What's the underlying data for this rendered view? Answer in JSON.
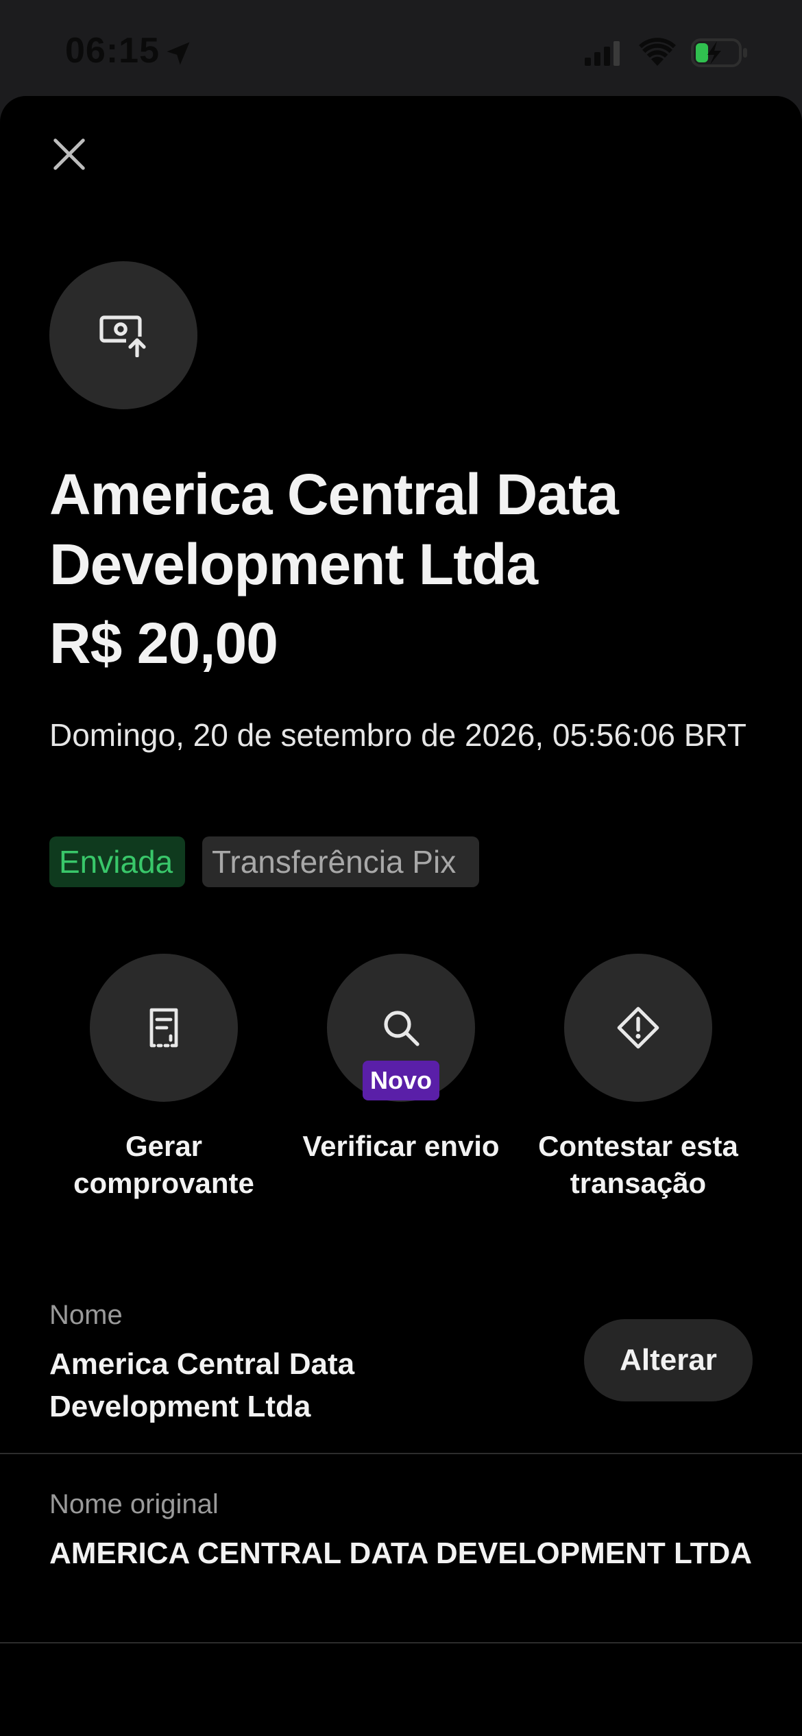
{
  "status_bar": {
    "time": "06:15",
    "icons": [
      "location-arrow-icon",
      "cellular-signal-icon",
      "wifi-icon",
      "battery-charging-icon"
    ]
  },
  "sheet": {
    "close_icon": "close-icon",
    "hero_icon": "money-send-icon",
    "title": "America Central Data Development Ltda",
    "amount": "R$ 20,00",
    "datetime": "Domingo, 20 de setembro de 2026, 05:56:06 BRT",
    "badges": {
      "status": "Enviada",
      "type": "Transferência Pix"
    },
    "actions": [
      {
        "label": "Gerar comprovante",
        "icon": "receipt-icon"
      },
      {
        "label": "Verificar envio",
        "icon": "search-icon",
        "badge": "Novo"
      },
      {
        "label": "Contestar esta transação",
        "icon": "warning-diamond-icon"
      }
    ],
    "fields": {
      "name_label": "Nome",
      "name_value": "America Central Data Development Ltda",
      "alter_button": "Alterar",
      "original_name_label": "Nome original",
      "original_name_value": "AMERICA CENTRAL DATA DEVELOPMENT LTDA"
    }
  },
  "colors": {
    "background": "#000000",
    "status_green": "#39c76a",
    "badge_green_bg": "#0f3a1e",
    "new_badge_purple": "#5a1fa8",
    "surface": "#2a2a2a"
  }
}
